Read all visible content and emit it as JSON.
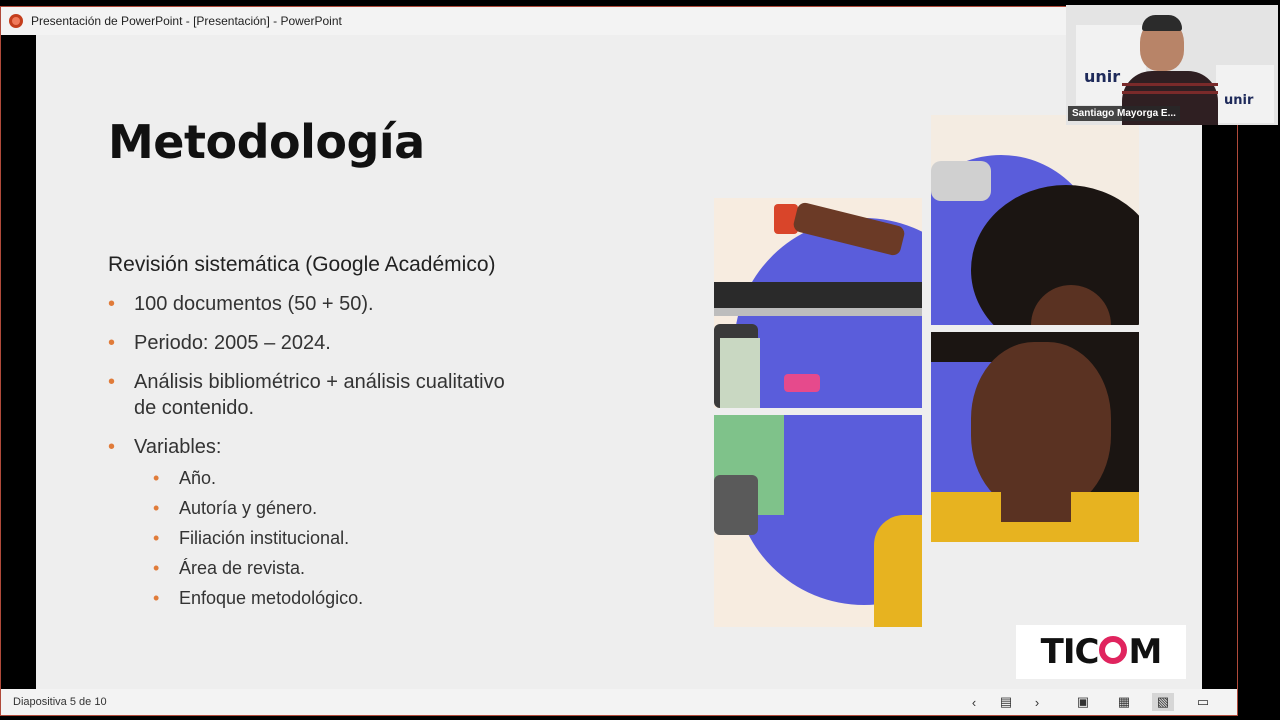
{
  "window": {
    "title": "Presentación de PowerPoint - [Presentación] - PowerPoint"
  },
  "slide": {
    "title": "Metodología",
    "subtitle": "Revisión sistemática (Google Académico)",
    "bullets": [
      "100 documentos (50 + 50).",
      "Periodo: 2005 – 2024.",
      "Análisis bibliométrico + análisis cualitativo de contenido.",
      "Variables:"
    ],
    "sub_bullets": [
      "Año.",
      "Autoría y género.",
      "Filiación institucional.",
      "Área de revista.",
      "Enfoque metodológico."
    ],
    "logo_text_left": "TIC",
    "logo_text_right": "M"
  },
  "statusbar": {
    "slide_counter": "Diapositiva 5 de 10"
  },
  "webcam": {
    "participant_name": "Santiago Mayorga E...",
    "logo_text": "unir"
  },
  "colors": {
    "bullet_accent": "#e07b39",
    "logo_accent": "#e0245e",
    "collage_blue": "#5a5ddb",
    "collage_yellow": "#e7b320"
  }
}
